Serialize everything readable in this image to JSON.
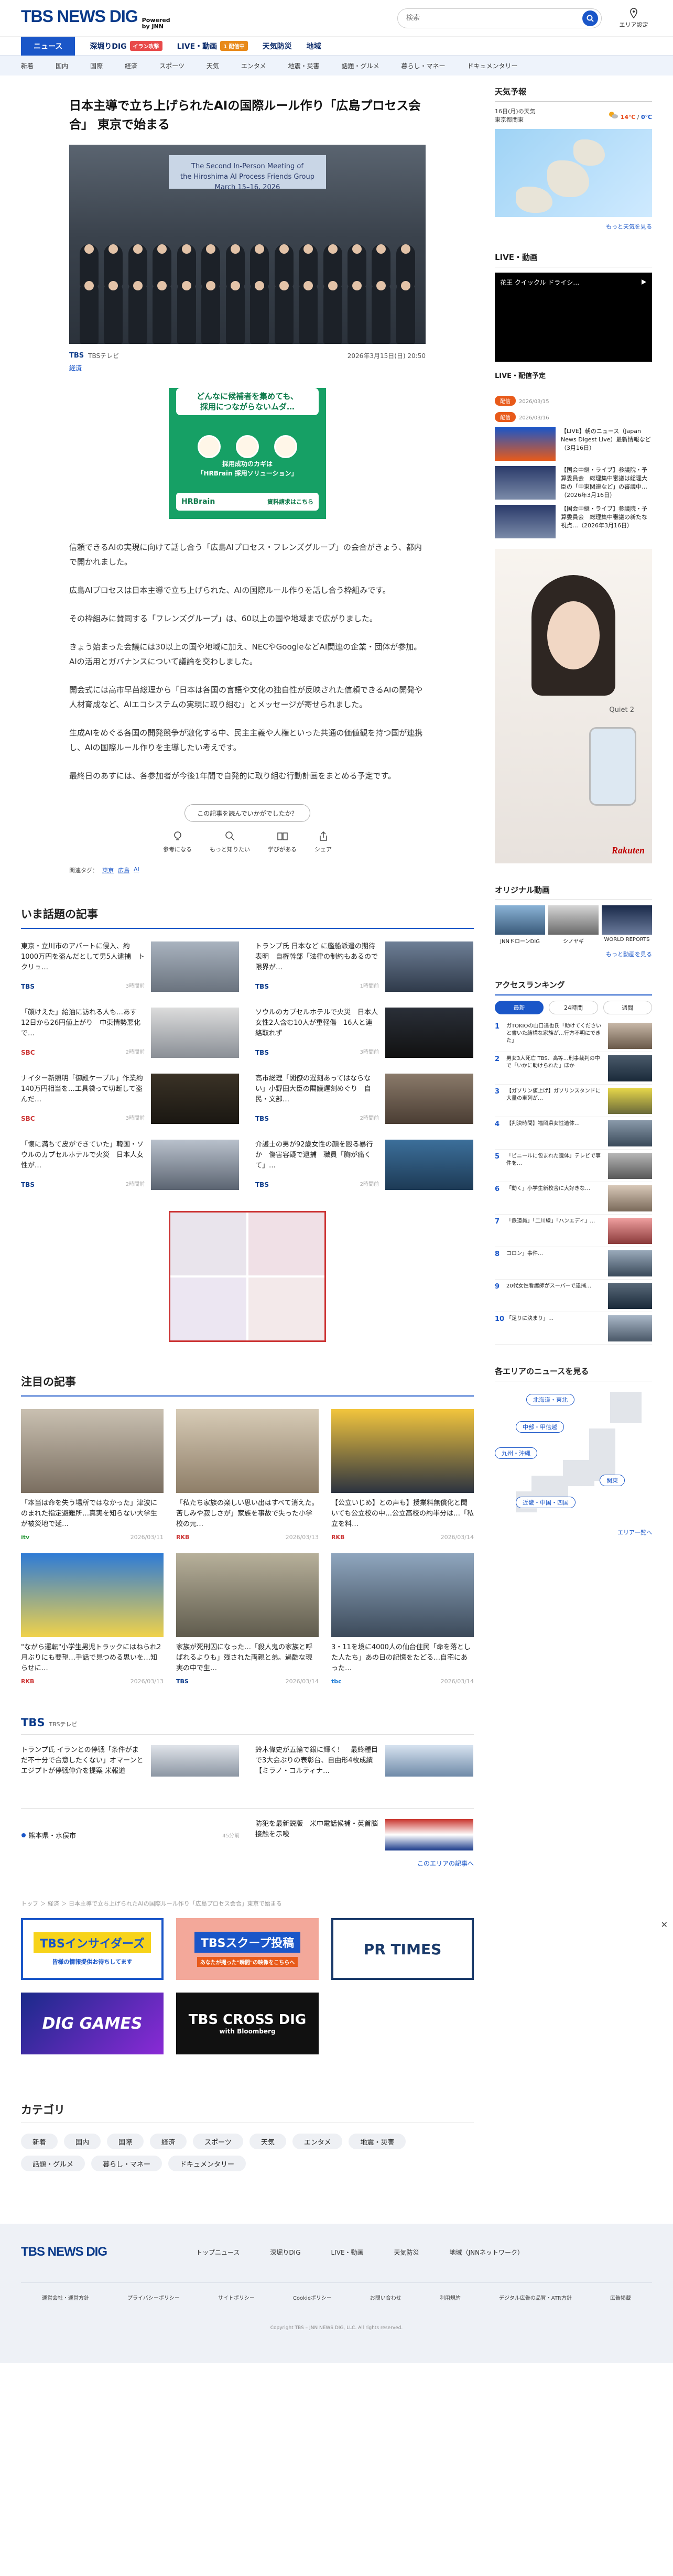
{
  "header": {
    "logo": "TBS NEWS DIG",
    "powered": "Powered\nby JNN",
    "search_placeholder": "検索",
    "area_setting": "エリア設定"
  },
  "nav1": [
    {
      "label": "ニュース",
      "active": true
    },
    {
      "label": "深堀りDIG",
      "badge": "イラン攻撃",
      "badge_color": "#e84a4a"
    },
    {
      "label": "LIVE・動画",
      "badge": "1 配信中",
      "badge_color": "#e88a1a"
    },
    {
      "label": "天気防災"
    },
    {
      "label": "地域"
    }
  ],
  "nav2": [
    "新着",
    "国内",
    "国際",
    "経済",
    "スポーツ",
    "天気",
    "エンタメ",
    "地震・災害",
    "話題・グルメ",
    "暮らし・マネー",
    "ドキュメンタリー"
  ],
  "article": {
    "title": "日本主導で立ち上げられたAIの国際ルール作り「広島プロセス会合」 東京で始まる",
    "photo_banner": "The Second In-Person Meeting of\nthe Hiroshima AI Process Friends Group\nMarch 15–16, 2026",
    "source": "TBS",
    "source_name": "TBSテレビ",
    "date": "2026年3月15日(日) 20:50",
    "tag": "経済",
    "ad": {
      "headline": "どんなに候補者を集めても、\n採用につながらないムダ…",
      "body": "採用成功のカギは\n「HRBrain 採用ソリューション」",
      "brand": "HRBrain",
      "cta": "資料請求はこちら"
    },
    "paragraphs": [
      "信頼できるAIの実現に向けて話し合う「広島AIプロセス・フレンズグループ」の会合がきょう、都内で開かれました。",
      "広島AIプロセスは日本主導で立ち上げられた、AIの国際ルール作りを話し合う枠組みです。",
      "その枠組みに賛同する「フレンズグループ」は、60以上の国や地域まで広がりました。",
      "きょう始まった会議には30以上の国や地域に加え、NECやGoogleなどAI関連の企業・団体が参加。AIの活用とガバナンスについて議論を交わしました。",
      "開会式には高市早苗総理から「日本は各国の言語や文化の独自性が反映された信頼できるAIの開発や人材育成など、AIエコシステムの実現に取り組む」とメッセージが寄せられました。",
      "生成AIをめぐる各国の開発競争が激化する中、民主主義や人権といった共通の価値観を持つ国が連携し、AIの国際ルール作りを主導したい考えです。",
      "最終日のあすには、各参加者が今後1年間で自発的に取り組む行動計画をまとめる予定です。"
    ],
    "react_question": "この記事を読んでいかがでしたか？",
    "reactions": [
      "参考になる",
      "もっと知りたい",
      "学びがある",
      "シェア"
    ],
    "related_label": "関連タグ：",
    "related_tags": [
      "東京",
      "広島",
      "AI"
    ]
  },
  "trending": {
    "title": "いま話題の記事",
    "items": [
      {
        "text": "東京・立川市のアパートに侵入、約1000万円を盗んだとして男5人逮捕　トクリュ…",
        "src": "TBS",
        "time": "3時間前"
      },
      {
        "text": "トランプ氏 日本など に艦船派遣の期待表明　自権幹部「法律の制約もあるので限界が…",
        "src": "TBS",
        "time": "1時間前"
      },
      {
        "text": "「顔けえた」給油に訪れる人も…あす12日から26円値上がり　中東情勢悪化で…",
        "src": "SBC",
        "time": "2時間前"
      },
      {
        "text": "ソウルのカプセルホテルで火災　日本人女性2人含む10人が重軽傷　16人と連絡取れず",
        "src": "TBS",
        "time": "3時間前"
      },
      {
        "text": "ナイター新照明「御殿ケーブル」作業約140万円相当を…工具袋って切断して盗んだ…",
        "src": "SBC",
        "time": "3時間前"
      },
      {
        "text": "高市総理「閣僚の遅刻あってはならない」小野田大臣の閣議遅刻めぐり　自民・文部…",
        "src": "TBS",
        "time": "2時間前"
      },
      {
        "text": "「懐に満ちて皮ができていた」韓国・ソウルのカプセルホテルで火災　日本人女性が…",
        "src": "TBS",
        "time": "2時間前"
      },
      {
        "text": "介護士の男が92歳女性の顔を殴る暴行か　傷害容疑で逮捕　職員「胸が痛くて」…",
        "src": "TBS",
        "time": "2時間前"
      }
    ]
  },
  "featured": {
    "title": "注目の記事",
    "items": [
      {
        "text": "「本当は命を失う場所ではなかった」津波にのまれた指定避難所…真実を知らない大学生が被災地で延…",
        "src": "itv",
        "time": "2026/03/11"
      },
      {
        "text": "「私たち家族の楽しい思い出はすべて消えた。苦しみや寂しさが」家族を事故で失った小学校の元…",
        "src": "RKB",
        "time": "2026/03/13"
      },
      {
        "text": "【公立いじめ】との声も】授業料無償化と聞いても公立校の中…公立高校の約半分は…「私立を料…",
        "src": "RKB",
        "time": "2026/03/14"
      },
      {
        "text": "\"ながら運転\"小学生男児トラックにはねられ2月ぶりにも要望…手話で見つめる思いを…知らせに…",
        "src": "RKB",
        "time": "2026/03/13"
      },
      {
        "text": "家族が死刑囚になった…「殺人鬼の家族と呼ばれるよりも」残された両親と弟。過酷な現実の中で生…",
        "src": "TBS",
        "time": "2026/03/14"
      },
      {
        "text": "3・11を境に4000人の仙台住民「命を落とした人たち」あの日の記憶をたどる…自宅にあった…",
        "src": "tbc",
        "time": "2026/03/14"
      }
    ]
  },
  "tbs_block": {
    "title": "TBS",
    "sub": "TBSテレビ",
    "items": [
      "トランプ氏 イランとの停戦「条件がまだ不十分で合意したくない」オマーンとエジプトが停戦仲介を提案 米報道",
      "鈴木偉史が五輪で銀に輝く！　最終種目で3大会ぶりの表彰台、自由形4枚成績【ミラノ・コルティナ…"
    ]
  },
  "local": {
    "area": "熊本県・水俣市",
    "time": "45分前",
    "headline": "防犯を最新鋭版　米中電話候補・英首脳接触を示唆",
    "more": "このエリアの記事へ"
  },
  "breadcrumb": "トップ ＞ 経済 ＞ 日本主導で立ち上げられたAIの国際ルール作り「広島プロセス会合」東京で始まる",
  "banners": [
    {
      "label": "TBSインサイダーズ",
      "sub": "皆様の情報提供お待ちしてます"
    },
    {
      "label": "TBSスクープ投稿",
      "sub": "あなたが撮った\"瞬間\"の映像をこちらへ"
    },
    {
      "label": "PR TIMES"
    },
    {
      "label": "DIG GAMES"
    },
    {
      "label": "TBS CROSS DIG",
      "sub": "with Bloomberg"
    }
  ],
  "categories": {
    "title": "カテゴリ",
    "items": [
      "新着",
      "国内",
      "国際",
      "経済",
      "スポーツ",
      "天気",
      "エンタメ",
      "地震・災害",
      "話題・グルメ",
      "暮らし・マネー",
      "ドキュメンタリー"
    ]
  },
  "sidebar": {
    "weather": {
      "title": "天気予報",
      "date": "16日(月)の天気",
      "region": "東京都関東",
      "high": "14℃",
      "low": "0℃",
      "more": "もっと天気を見る"
    },
    "live": {
      "title": "LIVE・動画",
      "video_text": "花王 クイックル ドライシ…",
      "schedule_title": "LIVE・配信予定"
    },
    "schedule": [
      {
        "tag": "配信",
        "date": "2026/03/15",
        "text": "【LIVE】朝のニュース（Japan News Digest Live）最新情報など（3月16日）",
        "time": "4日前"
      },
      {
        "tag": "配信",
        "date": "2026/03/16",
        "text": "【国会中継・ライブ】参議院・予算委員会　総理集中審議は総理大臣の「中東関連など」の審議中…（2026年3月16日）",
        "time": "2日前"
      },
      {
        "text": "【国会中継・ライブ】参議院・予算委員会　総理集中審議の新たな視点…（2026年3月16日）",
        "time": "2日前"
      }
    ],
    "ad": {
      "brand": "Rakuten",
      "product": "Quiet 2"
    },
    "original": {
      "title": "オリジナル動画",
      "items": [
        "JNNドローンDIG",
        "シノヤギ",
        "WORLD REPORTS"
      ],
      "more": "もっと動画を見る"
    },
    "ranking": {
      "title": "アクセスランキング",
      "tabs": [
        "最新",
        "24時間",
        "週間"
      ],
      "items": [
        "ガTOKIOの山口達也氏「助けてくださいと書いた結構な家族が…行方不明にできた」",
        "男女3人死亡 TBS、高等…刑事裁判の中で「いかに助けられた」ほか",
        "【ガソリン値上げ】ガソリンスタンドに大量の車列が…",
        "【判決時間】福岡県女性遺体…",
        "「ビニールに包まれた遺体」テレビで事件を…",
        "「動く」小学生新校舎に大好きな…",
        "「鉄道員」「二川線」「ハンエディ」…",
        "コロン」事件…",
        "20代女性看護師がスーパーで逮捕…",
        "「足りに決まり」…"
      ]
    },
    "areas": {
      "title": "各エリアのニュースを見る",
      "buttons": [
        "北海道・東北",
        "中部・甲信越",
        "九州・沖縄",
        "関東",
        "近畿・中国・四国"
      ],
      "more": "エリア一覧へ"
    }
  },
  "footer": {
    "logo": "TBS NEWS DIG",
    "links": [
      "トップニュース",
      "深堀りDIG",
      "LIVE・動画",
      "天気防災",
      "地域（JNNネットワーク）"
    ],
    "bottom": [
      "運営会社・運営方針",
      "プライバシーポリシー",
      "サイトポリシー",
      "Cookieポリシー",
      "お問い合わせ",
      "利用規約",
      "デジタル広告の品質・ATR方針",
      "広告掲載"
    ],
    "copyright": "Copyright TBS – JNN NEWS DIG, LLC. All rights reserved."
  }
}
